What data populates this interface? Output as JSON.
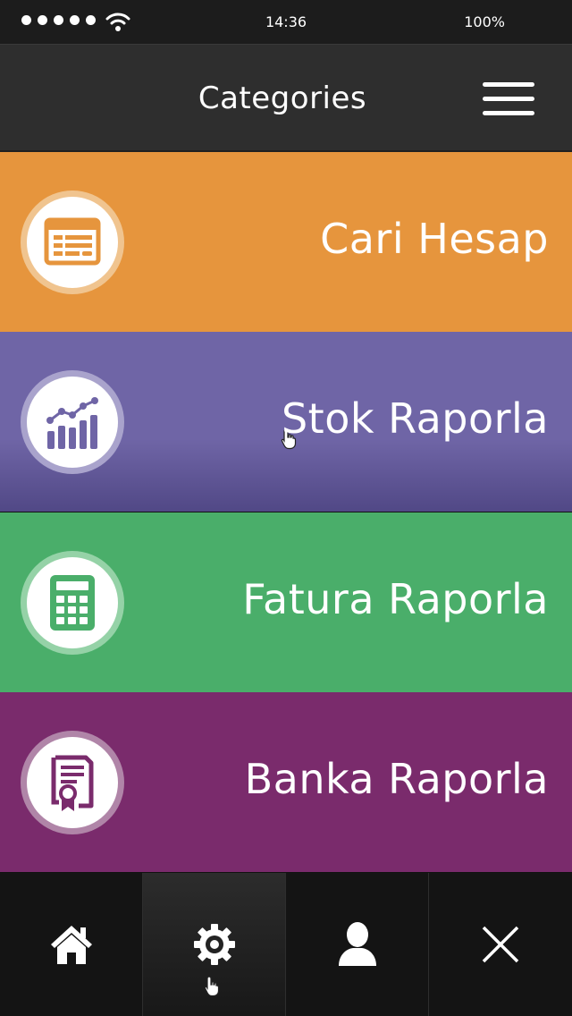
{
  "status_bar": {
    "signal_dots": 5,
    "time": "14:36",
    "battery": "100%"
  },
  "header": {
    "title": "Categories",
    "menu_icon": "hamburger-menu-icon"
  },
  "categories": [
    {
      "label": "Cari Hesap",
      "icon": "ledger-icon",
      "color": "#e6953d",
      "ring": "#f0c48f"
    },
    {
      "label": "Stok Raporla",
      "icon": "growth-chart-icon",
      "color": "#6f65a6",
      "ring": "#a9a3cc"
    },
    {
      "label": "Fatura Raporla",
      "icon": "calculator-icon",
      "color": "#4aae6a",
      "ring": "#95d2a7"
    },
    {
      "label": "Banka Raporla",
      "icon": "certificate-icon",
      "color": "#7a2b6c",
      "ring": "#b085a8"
    }
  ],
  "tab_bar": {
    "tabs": [
      {
        "icon": "home-icon"
      },
      {
        "icon": "gear-icon",
        "active": true
      },
      {
        "icon": "user-icon"
      },
      {
        "icon": "close-icon"
      }
    ]
  }
}
